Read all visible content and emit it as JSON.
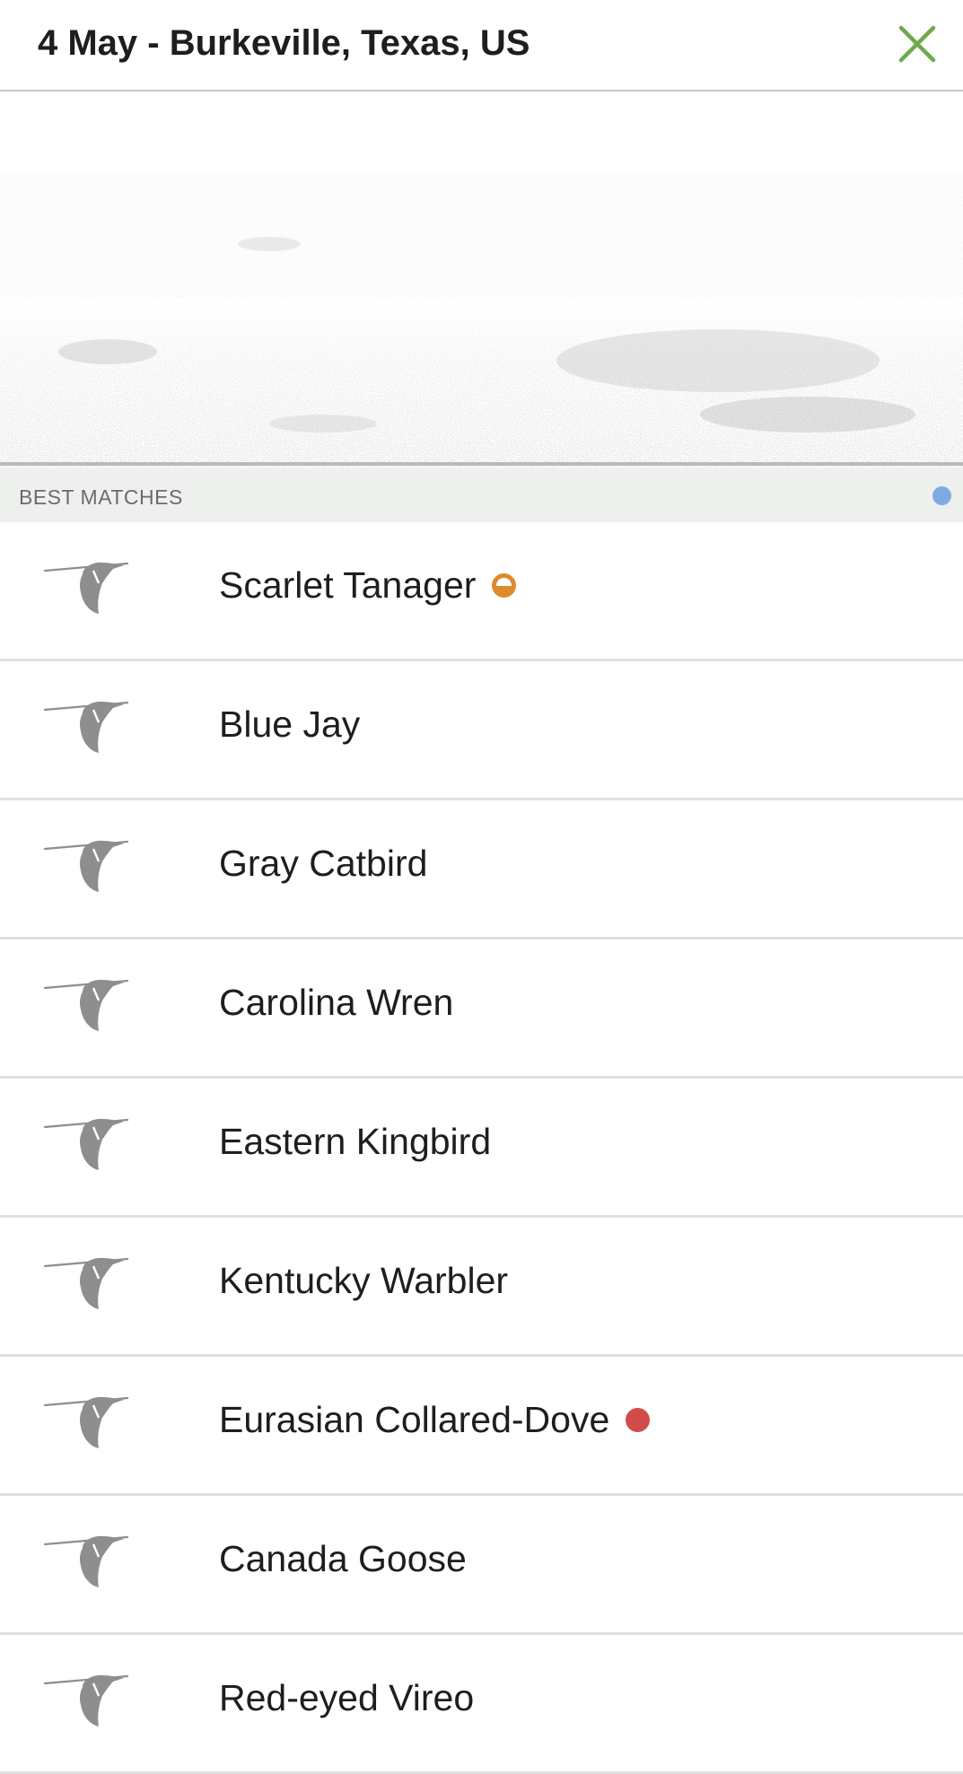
{
  "header": {
    "title": "4 May - Burkeville, Texas, US",
    "close_icon": "close-icon",
    "accent_color": "#6ea94a"
  },
  "spectrogram": {
    "icon": "spectrogram-image"
  },
  "section": {
    "label": "BEST MATCHES",
    "dot_color": "#7fa9e3"
  },
  "matches": [
    {
      "name": "Scarlet Tanager",
      "badge": "orange-half-circle",
      "badge_color": "#df8a2c"
    },
    {
      "name": "Blue Jay",
      "badge": null
    },
    {
      "name": "Gray Catbird",
      "badge": null
    },
    {
      "name": "Carolina Wren",
      "badge": null
    },
    {
      "name": "Eastern Kingbird",
      "badge": null
    },
    {
      "name": "Kentucky Warbler",
      "badge": null
    },
    {
      "name": "Eurasian Collared-Dove",
      "badge": "red-dot",
      "badge_color": "#d24b4b"
    },
    {
      "name": "Canada Goose",
      "badge": null
    },
    {
      "name": "Red-eyed Vireo",
      "badge": null
    }
  ]
}
